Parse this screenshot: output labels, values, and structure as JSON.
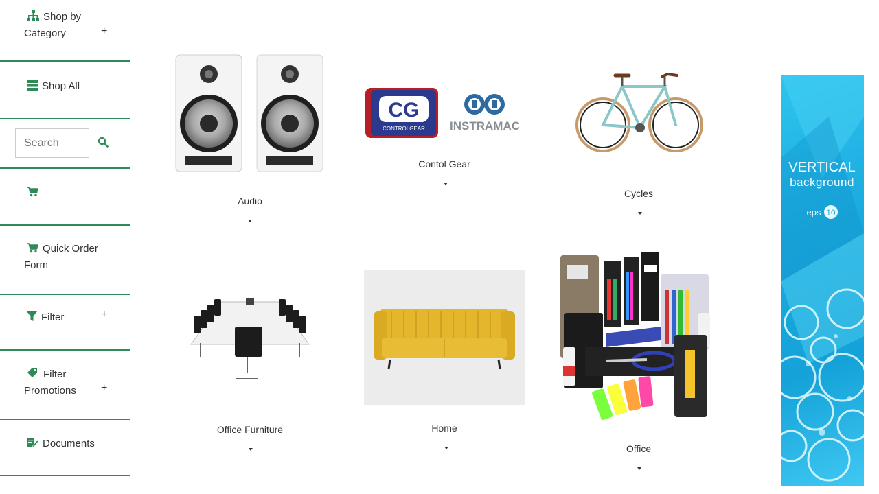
{
  "sidebar": {
    "shop_by_category_line1": "Shop by",
    "shop_by_category_line2": "Category",
    "shop_all": "Shop All",
    "search_placeholder": "Search",
    "quick_order_line1": "Quick Order",
    "quick_order_line2": "Form",
    "filter": "Filter",
    "filter_promotions_line1": "Filter",
    "filter_promotions_line2": "Promotions",
    "documents": "Documents",
    "plus": "+"
  },
  "products": [
    {
      "label": "Audio"
    },
    {
      "label": "Contol Gear"
    },
    {
      "label": "Cycles"
    },
    {
      "label": "Office Furniture"
    },
    {
      "label": "Home"
    },
    {
      "label": "Office"
    }
  ],
  "brand_logos": {
    "controlgear_mark": "CG",
    "controlgear_text": "CONTROLGEAR",
    "instramac_text": "INSTRAMAC"
  },
  "banner": {
    "line1": "VERTICAL",
    "line2": "background",
    "eps_label": "eps",
    "eps_num": "10"
  },
  "colors": {
    "accent": "#2e8b57",
    "banner_blue": "#1aa9dd"
  }
}
